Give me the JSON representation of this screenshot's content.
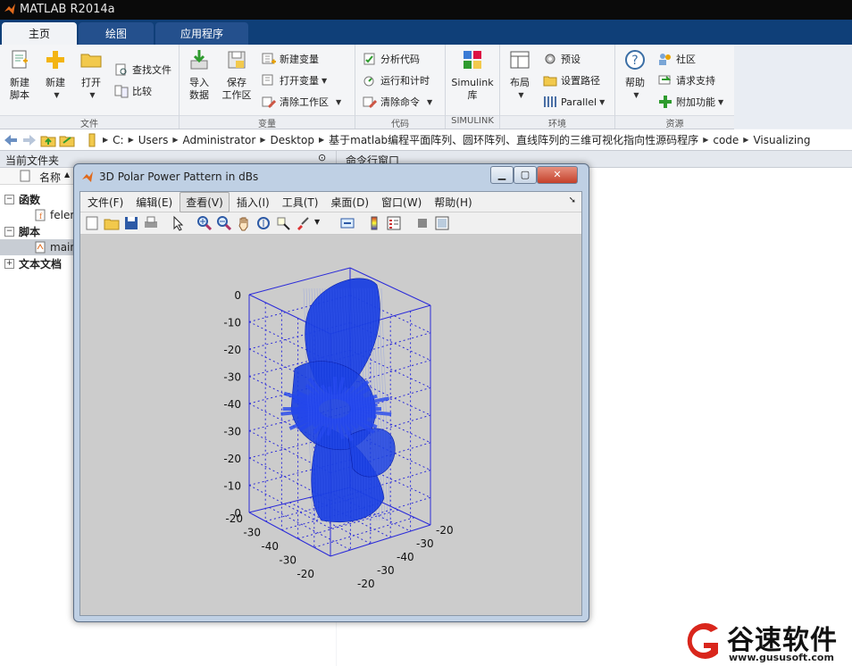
{
  "app": {
    "window_title": "MATLAB R2014a"
  },
  "tabs": [
    {
      "label": "主页",
      "active": true
    },
    {
      "label": "绘图",
      "active": false
    },
    {
      "label": "应用程序",
      "active": false
    }
  ],
  "ribbon": {
    "file": {
      "title": "文件",
      "new_script": "新建\n脚本",
      "new": "新建",
      "open": "打开",
      "find_files": "查找文件",
      "compare": "比较"
    },
    "variable": {
      "title": "变量",
      "import": "导入\n数据",
      "save_ws": "保存\n工作区",
      "new_var": "新建变量",
      "open_var": "打开变量",
      "clear_ws": "清除工作区"
    },
    "code": {
      "title": "代码",
      "analyze": "分析代码",
      "run_time": "运行和计时",
      "clear_cmd": "清除命令"
    },
    "simulink": {
      "title": "SIMULINK",
      "lib": "Simulink\n库"
    },
    "env": {
      "title": "环境",
      "layout": "布局",
      "prefs": "预设",
      "set_path": "设置路径",
      "parallel": "Parallel"
    },
    "resources": {
      "title": "资源",
      "help": "帮助",
      "community": "社区",
      "support": "请求支持",
      "addons": "附加功能"
    }
  },
  "address": {
    "crumbs": [
      "C:",
      "Users",
      "Administrator",
      "Desktop",
      "基于matlab编程平面阵列、圆环阵列、直线阵列的三维可视化指向性源码程序",
      "code",
      "Visualizing"
    ]
  },
  "left_panel": {
    "title": "当前文件夹",
    "column": "名称",
    "groups": [
      {
        "label": "函数",
        "items": [
          "feler"
        ]
      },
      {
        "label": "脚本",
        "items": [
          "main"
        ]
      },
      {
        "label": "文本文档",
        "items": []
      }
    ]
  },
  "right_panel": {
    "title": "命令行窗口"
  },
  "figure": {
    "title": "3D Polar Power Pattern in dBs",
    "menu": [
      "文件(F)",
      "编辑(E)",
      "查看(V)",
      "插入(I)",
      "工具(T)",
      "桌面(D)",
      "窗口(W)",
      "帮助(H)"
    ],
    "active_menu_index": 2,
    "ticks_z": [
      "0",
      "-10",
      "-20",
      "-30",
      "-40",
      "-30",
      "-20",
      "-10",
      "0"
    ],
    "ticks_left": [
      "-20",
      "-30",
      "-40",
      "-30",
      "-20"
    ],
    "ticks_right": [
      "-20",
      "-30",
      "-40",
      "-30",
      "-20"
    ],
    "surface_color": "#1a3fe0",
    "box_color": "#2b2bd9"
  },
  "watermark": {
    "brand": "谷速软件",
    "url": "www.gususoft.com"
  }
}
